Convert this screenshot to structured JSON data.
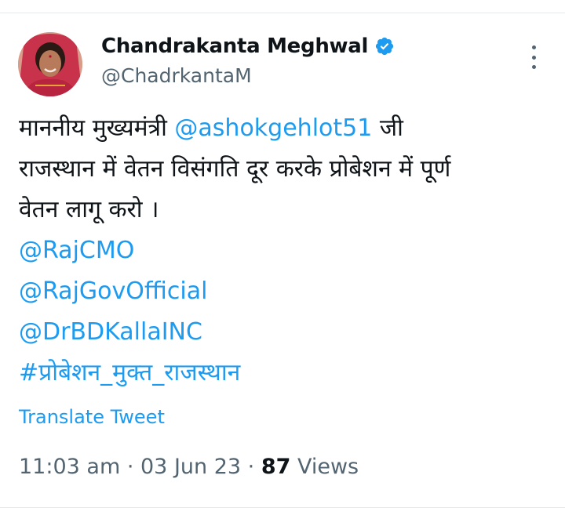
{
  "author": {
    "display_name": "Chandrakanta Meghwal",
    "handle": "@ChadrkantaM",
    "verified": true,
    "avatar_icon": "profile-photo"
  },
  "tweet": {
    "line1_text": "माननीय मुख्यमंत्री ",
    "line1_mention": "@ashokgehlot51",
    "line1_suffix": " जी",
    "line2": "राजस्थान में  वेतन विसंगति दूर करके प्रोबेशन में पूर्ण",
    "line3": "वेतन लागू करो ।",
    "mentions": [
      "@RajCMO",
      "@RajGovOfficial",
      "@DrBDKallaINC"
    ],
    "hashtag": "#प्रोबेशन_मुक्त_राजस्थान"
  },
  "translate_label": "Translate Tweet",
  "meta": {
    "time": "11:03 am",
    "separator": " · ",
    "date": "03 Jun 23",
    "views_count": "87",
    "views_label": " Views"
  },
  "colors": {
    "link": "#1d9bf0",
    "text": "#0f1419",
    "secondary": "#536471",
    "verified": "#1d9bf0"
  }
}
